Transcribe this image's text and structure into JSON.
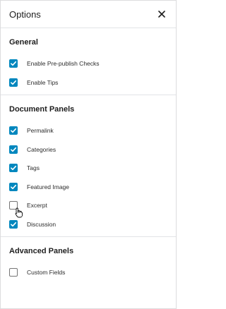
{
  "header": {
    "title": "Options",
    "close_icon": "close-icon"
  },
  "sections": [
    {
      "title": "General",
      "items": [
        {
          "label": "Enable Pre-publish Checks",
          "checked": true
        },
        {
          "label": "Enable Tips",
          "checked": true
        }
      ]
    },
    {
      "title": "Document Panels",
      "items": [
        {
          "label": "Permalink",
          "checked": true
        },
        {
          "label": "Categories",
          "checked": true
        },
        {
          "label": "Tags",
          "checked": true
        },
        {
          "label": "Featured Image",
          "checked": true
        },
        {
          "label": "Excerpt",
          "checked": false
        },
        {
          "label": "Discussion",
          "checked": true
        }
      ]
    },
    {
      "title": "Advanced Panels",
      "items": [
        {
          "label": "Custom Fields",
          "checked": false
        }
      ]
    }
  ],
  "colors": {
    "accent": "#0087be",
    "border": "#e2e4e7"
  }
}
